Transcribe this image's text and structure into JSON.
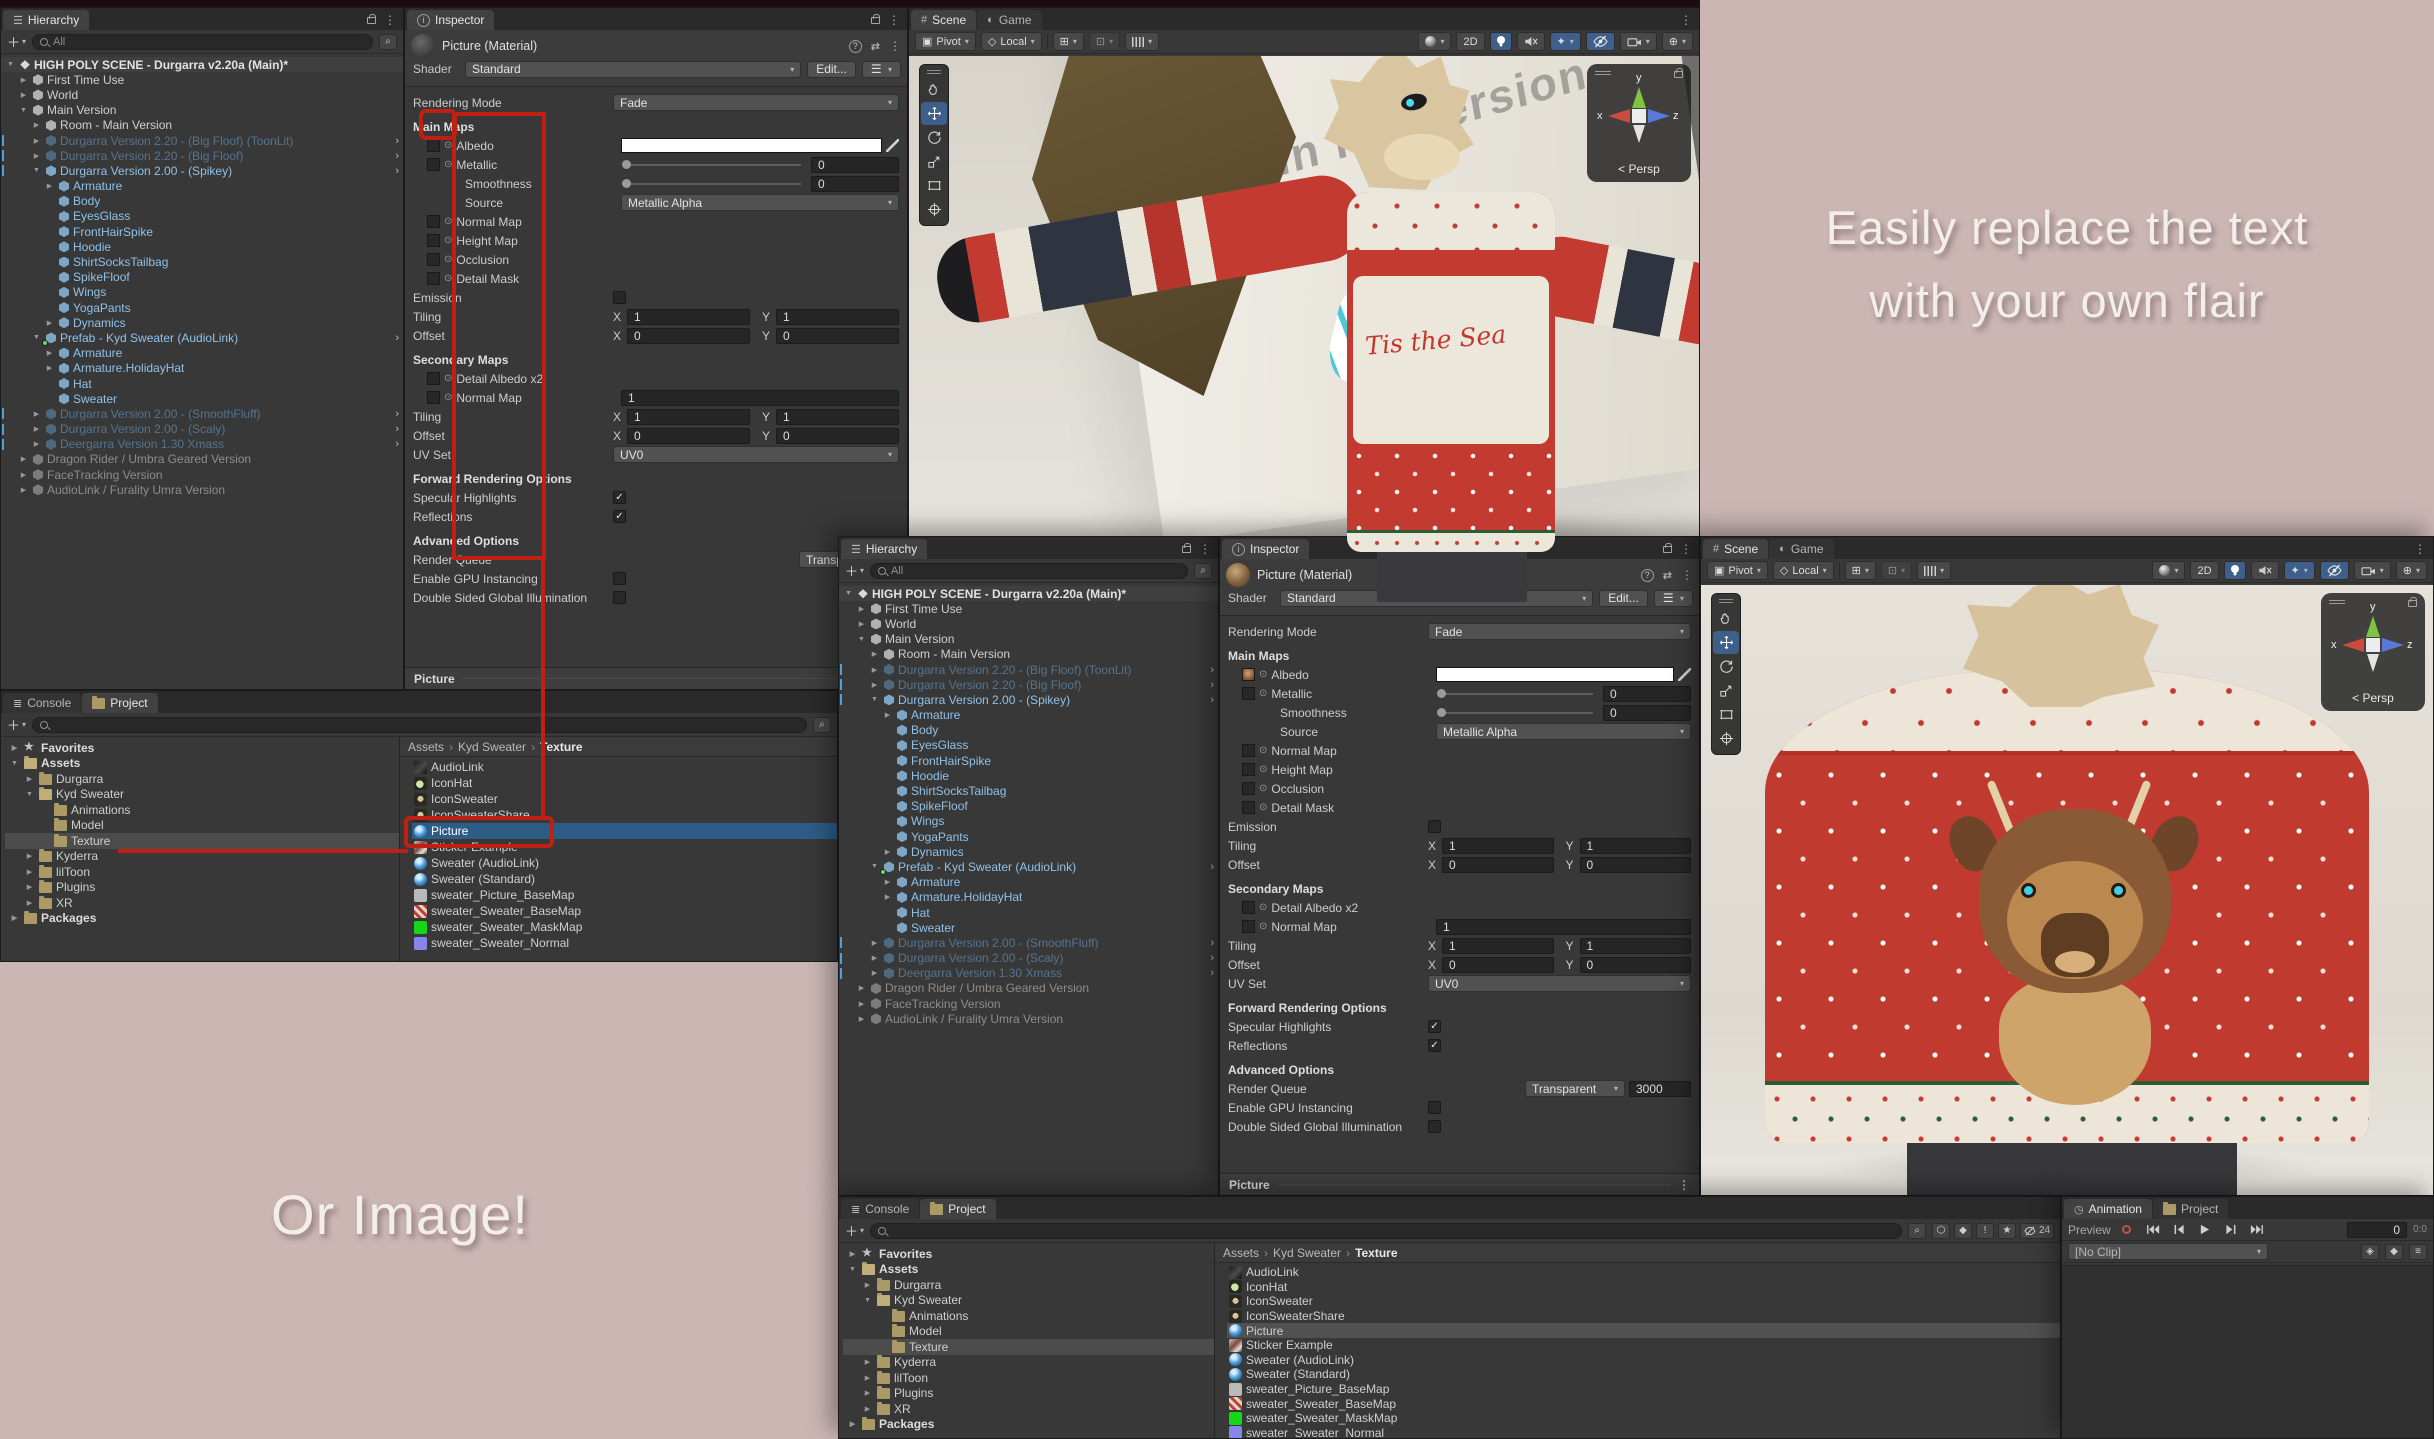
{
  "captions": {
    "headline_line1": "Easily replace the text",
    "headline_line2": "with your own flair",
    "secondary": "Or Image!"
  },
  "colors": {
    "annotation_red": "#c01f14",
    "background_pink": "#cbb6b4",
    "selection_blue": "#2d5c87",
    "prefab_blue": "#8fc1e8"
  },
  "hierarchy": {
    "tab": "Hierarchy",
    "search_placeholder": "All",
    "items": [
      {
        "label": "HIGH POLY SCENE - Durgarra v2.20a (Main)*",
        "depth": 0,
        "cls": "row-scene",
        "arrow": "open",
        "icon": "unity",
        "kebab": true
      },
      {
        "label": "First Time Use",
        "depth": 1,
        "cls": "row-norm",
        "arrow": "closed",
        "icon": "cube"
      },
      {
        "label": "World",
        "depth": 1,
        "cls": "row-norm",
        "arrow": "closed",
        "icon": "cube"
      },
      {
        "label": "Main Version",
        "depth": 1,
        "cls": "row-norm",
        "arrow": "open",
        "icon": "cube"
      },
      {
        "label": "Room - Main Version",
        "depth": 2,
        "cls": "row-norm",
        "arrow": "closed",
        "icon": "cube"
      },
      {
        "label": "Durgarra Version 2.20 - (Big Floof) (ToonLit)",
        "depth": 2,
        "cls": "row-dimblue",
        "arrow": "closed",
        "icon": "cube",
        "chev": true,
        "mark": true
      },
      {
        "label": "Durgarra Version 2.20 - (Big Floof)",
        "depth": 2,
        "cls": "row-dimblue",
        "arrow": "closed",
        "icon": "cube",
        "chev": true,
        "mark": true
      },
      {
        "label": "Durgarra Version 2.00 - (Spikey)",
        "depth": 2,
        "cls": "row-blue",
        "arrow": "open",
        "icon": "cube",
        "chev": true,
        "mark": true
      },
      {
        "label": "Armature",
        "depth": 3,
        "cls": "row-blue",
        "arrow": "closed",
        "icon": "cube"
      },
      {
        "label": "Body",
        "depth": 3,
        "cls": "row-blue",
        "arrow": "none",
        "icon": "cube"
      },
      {
        "label": "EyesGlass",
        "depth": 3,
        "cls": "row-blue",
        "arrow": "none",
        "icon": "cube"
      },
      {
        "label": "FrontHairSpike",
        "depth": 3,
        "cls": "row-blue",
        "arrow": "none",
        "icon": "cube"
      },
      {
        "label": "Hoodie",
        "depth": 3,
        "cls": "row-blue",
        "arrow": "none",
        "icon": "cube"
      },
      {
        "label": "ShirtSocksTailbag",
        "depth": 3,
        "cls": "row-blue",
        "arrow": "none",
        "icon": "cube"
      },
      {
        "label": "SpikeFloof",
        "depth": 3,
        "cls": "row-blue",
        "arrow": "none",
        "icon": "cube"
      },
      {
        "label": "Wings",
        "depth": 3,
        "cls": "row-blue",
        "arrow": "none",
        "icon": "cube"
      },
      {
        "label": "YogaPants",
        "depth": 3,
        "cls": "row-blue",
        "arrow": "none",
        "icon": "cube"
      },
      {
        "label": "Dynamics",
        "depth": 3,
        "cls": "row-blue",
        "arrow": "closed",
        "icon": "cube"
      },
      {
        "label": "Prefab - Kyd Sweater (AudioLink)",
        "depth": 2,
        "cls": "row-blue",
        "arrow": "open",
        "icon": "cube",
        "chev": true,
        "green": true
      },
      {
        "label": "Armature",
        "depth": 3,
        "cls": "row-blue",
        "arrow": "closed",
        "icon": "cube"
      },
      {
        "label": "Armature.HolidayHat",
        "depth": 3,
        "cls": "row-blue",
        "arrow": "closed",
        "icon": "cube"
      },
      {
        "label": "Hat",
        "depth": 3,
        "cls": "row-blue",
        "arrow": "none",
        "icon": "cube"
      },
      {
        "label": "Sweater",
        "depth": 3,
        "cls": "row-blue",
        "arrow": "none",
        "icon": "cube"
      },
      {
        "label": "Durgarra Version 2.00 - (SmoothFluff)",
        "depth": 2,
        "cls": "row-dimblue",
        "arrow": "closed",
        "icon": "cube",
        "chev": true,
        "mark": true
      },
      {
        "label": "Durgarra Version 2.00 - (Scaly)",
        "depth": 2,
        "cls": "row-dimblue",
        "arrow": "closed",
        "icon": "cube",
        "chev": true,
        "mark": true
      },
      {
        "label": "Deergarra Version 1.30 Xmass",
        "depth": 2,
        "cls": "row-dimblue",
        "arrow": "closed",
        "icon": "cube",
        "chev": true,
        "mark": true
      },
      {
        "label": "Dragon Rider / Umbra Geared Version",
        "depth": 1,
        "cls": "row-dimgray",
        "arrow": "closed",
        "icon": "cube"
      },
      {
        "label": "FaceTracking Version",
        "depth": 1,
        "cls": "row-dimgray",
        "arrow": "closed",
        "icon": "cube"
      },
      {
        "label": "AudioLink / Furality Umra Version",
        "depth": 1,
        "cls": "row-dimgray",
        "arrow": "closed",
        "icon": "cube"
      }
    ]
  },
  "inspector": {
    "tab": "Inspector",
    "title": "Picture (Material)",
    "shader_label": "Shader",
    "shader_value": "Standard",
    "edit_button": "Edit...",
    "rendering_mode_label": "Rendering Mode",
    "rendering_mode_value": "Fade",
    "main_maps": "Main Maps",
    "albedo": "Albedo",
    "metallic": "Metallic",
    "metallic_value": "0",
    "smoothness": "Smoothness",
    "smoothness_value": "0",
    "source_label": "Source",
    "source_value": "Metallic Alpha",
    "normal_map": "Normal Map",
    "height_map": "Height Map",
    "occlusion": "Occlusion",
    "detail_mask": "Detail Mask",
    "emission": "Emission",
    "tiling": "Tiling",
    "offset": "Offset",
    "x": "X",
    "y": "Y",
    "tiling_x": "1",
    "tiling_y": "1",
    "offset_x": "0",
    "offset_y": "0",
    "secondary_maps": "Secondary Maps",
    "detail_albedo": "Detail Albedo x2",
    "secondary_normal_value": "1",
    "uv_set_label": "UV Set",
    "uv_set_value": "UV0",
    "forward_options": "Forward Rendering Options",
    "specular": "Specular Highlights",
    "reflections": "Reflections",
    "advanced_options": "Advanced Options",
    "render_queue": "Render Queue",
    "render_queue_value": "Transparent",
    "render_queue_number": "3000",
    "gpu_instancing": "Enable GPU Instancing",
    "double_sided": "Double Sided Global Illumination",
    "footer": "Picture"
  },
  "scene": {
    "tab_scene": "Scene",
    "tab_game": "Game",
    "pivot": "Pivot",
    "local": "Local",
    "mode_2d": "2D",
    "wall_text": "Main PC Version",
    "sweater_text": "Tis the Sea",
    "axis_x": "x",
    "axis_y": "y",
    "axis_z": "z",
    "persp": "< Persp"
  },
  "project": {
    "tab_console": "Console",
    "tab_project": "Project",
    "breadcrumb": [
      "Assets",
      "Kyd Sweater",
      "Texture"
    ],
    "hidden_count": "24",
    "folders": [
      {
        "label": "Favorites",
        "depth": 0,
        "icon": "star",
        "arrow": "closed",
        "cls": "frow-bold"
      },
      {
        "label": "Assets",
        "depth": 0,
        "icon": "fopen",
        "arrow": "open",
        "cls": "frow-bold"
      },
      {
        "label": "Durgarra",
        "depth": 1,
        "icon": "fclosed",
        "arrow": "closed"
      },
      {
        "label": "Kyd Sweater",
        "depth": 1,
        "icon": "fopen",
        "arrow": "open"
      },
      {
        "label": "Animations",
        "depth": 2,
        "icon": "fclosed",
        "arrow": "none"
      },
      {
        "label": "Model",
        "depth": 2,
        "icon": "fclosed",
        "arrow": "none"
      },
      {
        "label": "Texture",
        "depth": 2,
        "icon": "fclosed",
        "arrow": "none",
        "selected": true
      },
      {
        "label": "Kyderra",
        "depth": 1,
        "icon": "fclosed",
        "arrow": "closed"
      },
      {
        "label": "lilToon",
        "depth": 1,
        "icon": "fclosed",
        "arrow": "closed"
      },
      {
        "label": "Plugins",
        "depth": 1,
        "icon": "fclosed",
        "arrow": "closed"
      },
      {
        "label": "XR",
        "depth": 1,
        "icon": "fclosed",
        "arrow": "closed"
      },
      {
        "label": "Packages",
        "depth": 0,
        "icon": "fclosed",
        "arrow": "closed",
        "cls": "frow-bold"
      }
    ],
    "assets": [
      {
        "label": "AudioLink",
        "icon": "audiolink"
      },
      {
        "label": "IconHat",
        "icon": "iconhat"
      },
      {
        "label": "IconSweater",
        "icon": "iconsweater"
      },
      {
        "label": "IconSweaterShare",
        "icon": "iconsweater"
      },
      {
        "label": "Picture",
        "icon": "mat",
        "selected": true
      },
      {
        "label": "Sticker Example",
        "icon": "sticker"
      },
      {
        "label": "Sweater (AudioLink)",
        "icon": "mat"
      },
      {
        "label": "Sweater (Standard)",
        "icon": "mat"
      },
      {
        "label": "sweater_Picture_BaseMap",
        "icon": "sw-gray"
      },
      {
        "label": "sweater_Sweater_BaseMap",
        "icon": "sw-red"
      },
      {
        "label": "sweater_Sweater_MaskMap",
        "icon": "sw-green"
      },
      {
        "label": "sweater_Sweater_Normal",
        "icon": "sw-purple"
      }
    ]
  },
  "animation": {
    "tab_animation": "Animation",
    "tab_project": "Project",
    "preview_label": "Preview",
    "frame_value": "0",
    "timecode": "0:0",
    "clip_value": "[No Clip]"
  }
}
